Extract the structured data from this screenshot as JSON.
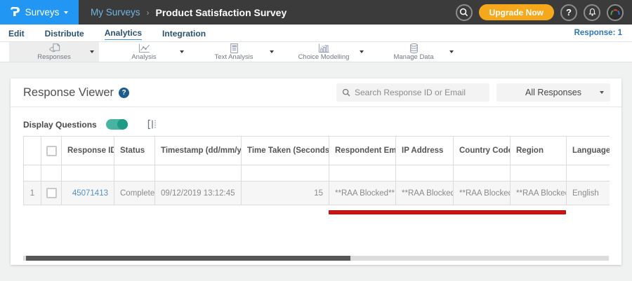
{
  "topbar": {
    "logo_glyph": "Ɂ",
    "product_menu": "Surveys",
    "breadcrumb": {
      "parent": "My Surveys",
      "separator": "›",
      "current": "Product Satisfaction Survey"
    },
    "upgrade_label": "Upgrade Now",
    "help_glyph": "?"
  },
  "subnav": {
    "items": [
      {
        "label": "Edit",
        "active": false
      },
      {
        "label": "Distribute",
        "active": false
      },
      {
        "label": "Analytics",
        "active": true
      },
      {
        "label": "Integration",
        "active": false
      }
    ],
    "response_count": "Response: 1"
  },
  "toolbar": {
    "tabs": [
      {
        "label": "Responses",
        "icon": "responses-icon",
        "active": true
      },
      {
        "label": "Analysis",
        "icon": "analysis-icon",
        "active": false
      },
      {
        "label": "Text Analysis",
        "icon": "text-analysis-icon",
        "active": false
      },
      {
        "label": "Choice Modelling",
        "icon": "choice-modelling-icon",
        "active": false
      },
      {
        "label": "Manage Data",
        "icon": "manage-data-icon",
        "active": false
      }
    ]
  },
  "viewer": {
    "title": "Response Viewer",
    "help_glyph": "?",
    "search_placeholder": "Search Response ID or Email",
    "filter_selected": "All Responses",
    "display_questions_label": "Display Questions",
    "display_questions_on": true
  },
  "table": {
    "columns": [
      "Response ID",
      "Status",
      "Timestamp (dd/mm/yyyy)",
      "Time Taken (Seconds)",
      "Respondent Email",
      "IP Address",
      "Country Code",
      "Region",
      "Language"
    ],
    "rows": [
      {
        "index": "1",
        "response_id": "45071413",
        "status": "Completed",
        "timestamp": "09/12/2019 13:12:45",
        "time_taken": "15",
        "respondent_email": "**RAA Blocked**",
        "ip_address": "**RAA Blocked**",
        "country_code": "**RAA Blocked**",
        "region": "**RAA Blocked**",
        "language": "English"
      }
    ]
  },
  "colors": {
    "brand_blue": "#2196f3",
    "topbar_dark": "#3b3b3b",
    "upgrade_orange": "#f6a81c",
    "toggle_teal": "#1d9b85",
    "highlight_red": "#cf1313",
    "link_blue": "#4e93c9",
    "nav_navy": "#2b5070"
  }
}
